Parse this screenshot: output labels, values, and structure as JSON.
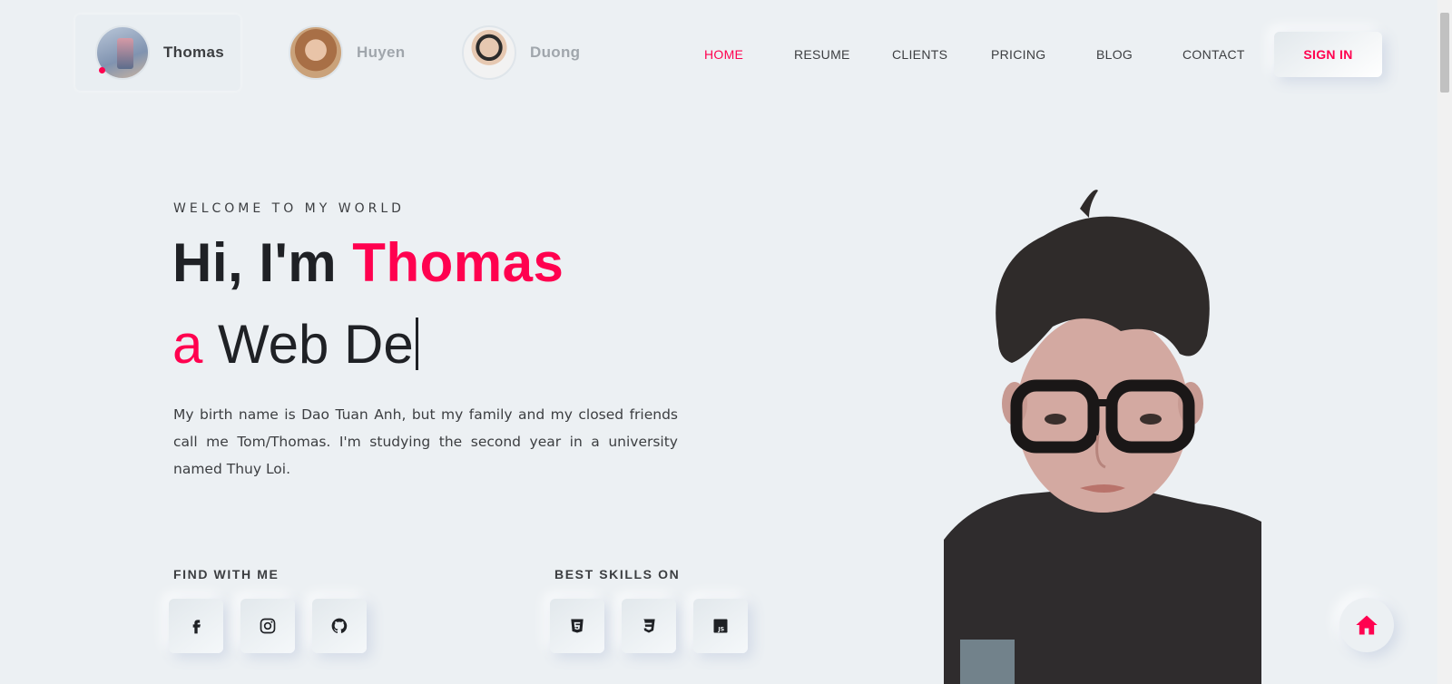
{
  "header": {
    "profiles": [
      {
        "name": "Thomas"
      },
      {
        "name": "Huyen"
      },
      {
        "name": "Duong"
      }
    ],
    "nav": [
      {
        "label": "HOME",
        "active": true
      },
      {
        "label": "RESUME"
      },
      {
        "label": "CLIENTS"
      },
      {
        "label": "PRICING"
      },
      {
        "label": "BLOG"
      },
      {
        "label": "CONTACT"
      }
    ],
    "signin_label": "SIGN IN"
  },
  "hero": {
    "subtitle": "WELCOME TO MY WORLD",
    "greeting": "Hi, I'm ",
    "name": "Thomas",
    "typed_prefix": "a",
    "typed_text": "Web De",
    "description": "My birth name is Dao Tuan Anh, but my family and my closed friends call me Tom/Thomas. I'm studying the second year in a university named Thuy Loi."
  },
  "social": {
    "title": "FIND WITH ME",
    "icons": [
      "facebook-icon",
      "instagram-icon",
      "github-icon"
    ]
  },
  "skills": {
    "title": "BEST SKILLS ON",
    "icons": [
      "html5-icon",
      "css3-icon",
      "javascript-icon"
    ]
  },
  "colors": {
    "accent": "#ff014f",
    "background": "#ecf0f3",
    "text": "#3c3e41"
  }
}
